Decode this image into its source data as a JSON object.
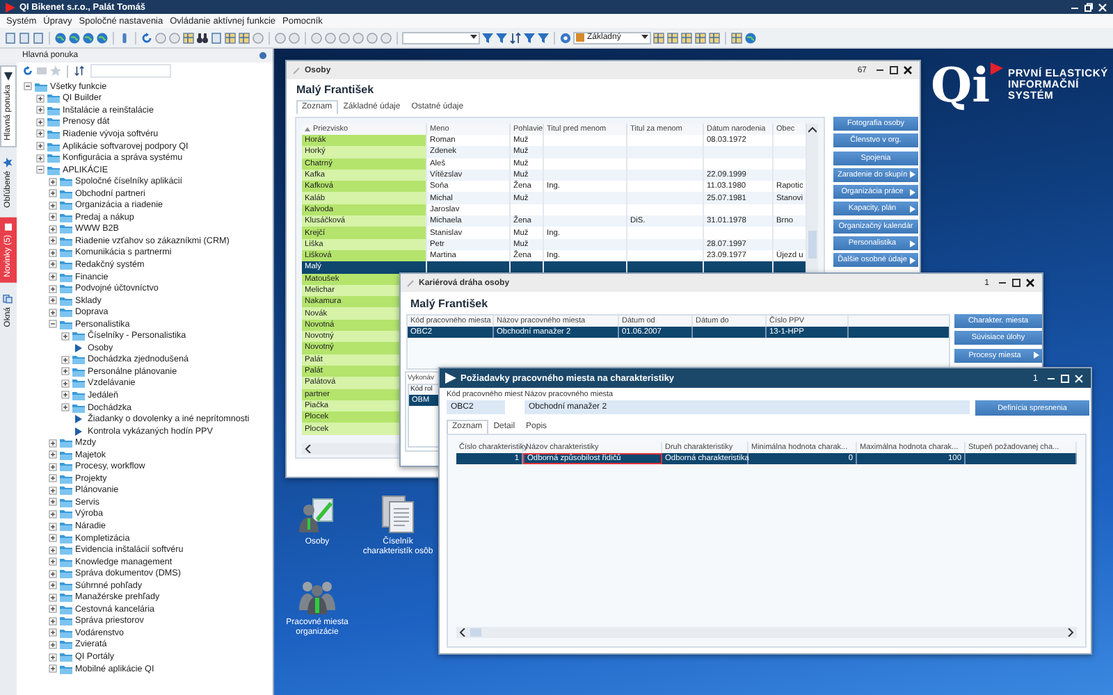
{
  "app": {
    "title": "QI Bikenet s.r.o., Palát Tomáš"
  },
  "menu": [
    "Systém",
    "Úpravy",
    "Spoločné nastavenia",
    "Ovládanie aktívnej funkcie",
    "Pomocník"
  ],
  "toolbar": {
    "view": "Základný"
  },
  "side_tabs": [
    {
      "label": "Hlavná ponuka",
      "kind": "menu",
      "selected": true
    },
    {
      "label": "Obľúbené",
      "kind": "favorites",
      "selected": false
    },
    {
      "label": "Novinky (5)",
      "kind": "news",
      "selected": false
    },
    {
      "label": "Okná",
      "kind": "windows",
      "selected": false
    }
  ],
  "main_menu": {
    "title": "Hlavná ponuka",
    "tree": [
      {
        "label": "Všetky funkcie",
        "kind": "folder",
        "expanded": true,
        "children": [
          {
            "label": "QI Builder",
            "kind": "folder",
            "expanded": false
          },
          {
            "label": "Inštalácie a reinštalácie",
            "kind": "folder",
            "expanded": false
          },
          {
            "label": "Prenosy dát",
            "kind": "folder",
            "expanded": false
          },
          {
            "label": "Riadenie vývoja softvéru",
            "kind": "folder",
            "expanded": false
          },
          {
            "label": "Aplikácie softvarovej podpory QI",
            "kind": "folder",
            "expanded": false
          },
          {
            "label": "Konfigurácia a správa systému",
            "kind": "folder",
            "expanded": false
          },
          {
            "label": "APLIKÁCIE",
            "kind": "folder",
            "expanded": true,
            "children": [
              {
                "label": "Spoločné číselníky aplikácií",
                "kind": "folder",
                "expanded": false
              },
              {
                "label": "Obchodní partneri",
                "kind": "folder",
                "expanded": false
              },
              {
                "label": "Organizácia a riadenie",
                "kind": "folder",
                "expanded": false
              },
              {
                "label": "Predaj a nákup",
                "kind": "folder",
                "expanded": false
              },
              {
                "label": "WWW B2B",
                "kind": "folder",
                "expanded": false
              },
              {
                "label": "Riadenie vzťahov so zákazníkmi (CRM)",
                "kind": "folder",
                "expanded": false
              },
              {
                "label": "Komunikácia s partnermi",
                "kind": "folder",
                "expanded": false
              },
              {
                "label": "Redakčný systém",
                "kind": "folder",
                "expanded": false
              },
              {
                "label": "Financie",
                "kind": "folder",
                "expanded": false
              },
              {
                "label": "Podvojné účtovníctvo",
                "kind": "folder",
                "expanded": false
              },
              {
                "label": "Sklady",
                "kind": "folder",
                "expanded": false
              },
              {
                "label": "Doprava",
                "kind": "folder",
                "expanded": false
              },
              {
                "label": "Personalistika",
                "kind": "folder",
                "expanded": true,
                "children": [
                  {
                    "label": "Číselníky - Personalistika",
                    "kind": "folder",
                    "expanded": false
                  },
                  {
                    "label": "Osoby",
                    "kind": "function"
                  },
                  {
                    "label": "Dochádzka zjednodušená",
                    "kind": "folder",
                    "expanded": false
                  },
                  {
                    "label": "Personálne plánovanie",
                    "kind": "folder",
                    "expanded": false
                  },
                  {
                    "label": "Vzdelávanie",
                    "kind": "folder",
                    "expanded": false
                  },
                  {
                    "label": "Jedáleň",
                    "kind": "folder",
                    "expanded": false
                  },
                  {
                    "label": "Dochádzka",
                    "kind": "folder",
                    "expanded": false
                  },
                  {
                    "label": "Žiadanky o dovolenky a iné neprítomnosti",
                    "kind": "function"
                  },
                  {
                    "label": "Kontrola vykázaných hodín PPV",
                    "kind": "function"
                  }
                ]
              },
              {
                "label": "Mzdy",
                "kind": "folder",
                "expanded": false
              },
              {
                "label": "Majetok",
                "kind": "folder",
                "expanded": false
              },
              {
                "label": "Procesy, workflow",
                "kind": "folder",
                "expanded": false
              },
              {
                "label": "Projekty",
                "kind": "folder",
                "expanded": false
              },
              {
                "label": "Plánovanie",
                "kind": "folder",
                "expanded": false
              },
              {
                "label": "Servis",
                "kind": "folder",
                "expanded": false
              },
              {
                "label": "Výroba",
                "kind": "folder",
                "expanded": false
              },
              {
                "label": "Náradie",
                "kind": "folder",
                "expanded": false
              },
              {
                "label": "Kompletizácia",
                "kind": "folder",
                "expanded": false
              },
              {
                "label": "Evidencia inštalácií softvéru",
                "kind": "folder",
                "expanded": false
              },
              {
                "label": "Knowledge management",
                "kind": "folder",
                "expanded": false
              },
              {
                "label": "Správa dokumentov (DMS)",
                "kind": "folder",
                "expanded": false
              },
              {
                "label": "Súhrnné pohľady",
                "kind": "folder",
                "expanded": false
              },
              {
                "label": "Manažérske prehľady",
                "kind": "folder",
                "expanded": false
              },
              {
                "label": "Cestovná kancelária",
                "kind": "folder",
                "expanded": false
              },
              {
                "label": "Správa priestorov",
                "kind": "folder",
                "expanded": false
              },
              {
                "label": "Vodárenstvo",
                "kind": "folder",
                "expanded": false
              },
              {
                "label": "Zvieratá",
                "kind": "folder",
                "expanded": false
              },
              {
                "label": "QI Portály",
                "kind": "folder",
                "expanded": false
              },
              {
                "label": "Mobilné aplikácie QI",
                "kind": "folder",
                "expanded": false
              }
            ]
          }
        ]
      }
    ]
  },
  "logo": {
    "mark": "Qi",
    "lines": [
      "PRVNÍ ELASTICKÝ",
      "INFORMAČNÍ",
      "SYSTÉM"
    ]
  },
  "osoby": {
    "title": "Osoby",
    "count": "67",
    "heading": "Malý František",
    "tabs": [
      {
        "label": "Zoznam",
        "selected": true
      },
      {
        "label": "Základné údaje",
        "selected": false
      },
      {
        "label": "Ostatné údaje",
        "selected": false
      }
    ],
    "columns": [
      {
        "label": "Priezvisko",
        "sorted": true
      },
      {
        "label": "Meno",
        "sorted": false
      },
      {
        "label": "Pohlavie",
        "sorted": false
      },
      {
        "label": "Titul pred menom",
        "sorted": false
      },
      {
        "label": "Titul za menom",
        "sorted": false
      },
      {
        "label": "Dátum narodenia",
        "sorted": false
      },
      {
        "label": "Obec",
        "sorted": false
      }
    ],
    "rows": [
      {
        "surname": "Horák",
        "first_name": "Roman",
        "gender": "Muž",
        "birth_date": "08.03.1972",
        "selected": false
      },
      {
        "surname": "Horký",
        "first_name": "Zdenek",
        "gender": "Muž",
        "selected": false
      },
      {
        "surname": "Chatrný",
        "first_name": "Aleš",
        "gender": "Muž",
        "selected": false
      },
      {
        "surname": "Kafka",
        "first_name": "Vítězslav",
        "gender": "Muž",
        "birth_date": "22.09.1999",
        "selected": false
      },
      {
        "surname": "Kafková",
        "first_name": "Soňa",
        "gender": "Žena",
        "title_before": "Ing.",
        "birth_date": "11.03.1980",
        "city": "Rapotic",
        "selected": false
      },
      {
        "surname": "Kaláb",
        "first_name": "Michal",
        "gender": "Muž",
        "birth_date": "25.07.1981",
        "city": "Stanovi",
        "selected": false
      },
      {
        "surname": "Kalvoda",
        "first_name": "Jaroslav",
        "selected": false
      },
      {
        "surname": "Klusáčková",
        "first_name": "Michaela",
        "gender": "Žena",
        "title_after": "DiS.",
        "birth_date": "31.01.1978",
        "city": "Brno",
        "selected": false
      },
      {
        "surname": "Krejčí",
        "first_name": "Stanislav",
        "gender": "Muž",
        "title_before": "Ing.",
        "selected": false
      },
      {
        "surname": "Liška",
        "first_name": "Petr",
        "gender": "Muž",
        "birth_date": "28.07.1997",
        "selected": false
      },
      {
        "surname": "Lišková",
        "first_name": "Martina",
        "gender": "Žena",
        "title_before": "Ing.",
        "birth_date": "23.09.1977",
        "city": "Újezd u",
        "selected": false
      },
      {
        "surname": "Malý",
        "selected": true
      },
      {
        "surname": "Matoušek",
        "selected": false
      },
      {
        "surname": "Melichar",
        "selected": false
      },
      {
        "surname": "Nakamura",
        "selected": false
      },
      {
        "surname": "Novák",
        "selected": false
      },
      {
        "surname": "Novotná",
        "selected": false
      },
      {
        "surname": "Novotný",
        "selected": false
      },
      {
        "surname": "Novotný",
        "selected": false
      },
      {
        "surname": "Palát",
        "selected": false
      },
      {
        "surname": "Palát",
        "selected": false
      },
      {
        "surname": "Palátová",
        "selected": false
      },
      {
        "surname": "partner",
        "selected": false
      },
      {
        "surname": "Piačka",
        "selected": false
      },
      {
        "surname": "Plocek",
        "selected": false
      },
      {
        "surname": "Plocek",
        "selected": false
      }
    ],
    "buttons": [
      {
        "label": "Fotografia osoby",
        "submenu": false
      },
      {
        "label": "Členstvo v org.",
        "submenu": false
      },
      {
        "label": "Spojenia",
        "submenu": false
      },
      {
        "label": "Zaradenie do skupín",
        "submenu": true
      },
      {
        "label": "Organizácia práce",
        "submenu": true
      },
      {
        "label": "Kapacity, plán",
        "submenu": true
      },
      {
        "label": "Organizačný kalendár",
        "submenu": false
      },
      {
        "label": "Personalistika",
        "submenu": true
      },
      {
        "label": "Ďalšie osobné údaje",
        "submenu": true
      }
    ]
  },
  "career": {
    "title": "Kariérová dráha osoby",
    "count": "1",
    "heading": "Malý František",
    "columns": [
      "Kód pracovného miesta",
      "Názov pracovného miesta",
      "Dátum od",
      "Dátum do",
      "Číslo PPV"
    ],
    "rows": [
      {
        "code": "OBC2",
        "name": "Obchodní manažer 2",
        "from": "01.06.2007",
        "ppv": "13-1-HPP",
        "selected": true
      }
    ],
    "buttons": [
      {
        "label": "Charakter. miesta",
        "submenu": false
      },
      {
        "label": "Súvisiace úlohy",
        "submenu": false
      },
      {
        "label": "Procesy miesta",
        "submenu": true
      }
    ],
    "group": {
      "label": "Vykonáv",
      "column": "Kód rol",
      "rows": [
        {
          "code": "OBM",
          "selected": true
        }
      ]
    }
  },
  "requirements": {
    "title": "Požiadavky pracovného miesta na charakteristiky",
    "count": "1",
    "code_label": "Kód pracovného miest",
    "code": "OBC2",
    "name_label": "Názov pracovného miesta",
    "name": "Obchodní manažer 2",
    "button": "Definícia spresnenia",
    "tabs": [
      {
        "label": "Zoznam",
        "selected": true
      },
      {
        "label": "Detail",
        "selected": false
      },
      {
        "label": "Popis",
        "selected": false
      }
    ],
    "columns": [
      {
        "label": "Číslo charakteristiky",
        "kind": "number"
      },
      {
        "label": "Názov charakteristiky",
        "kind": "text"
      },
      {
        "label": "Druh charakteristiky",
        "kind": "text"
      },
      {
        "label": "Minimálna hodnota charak...",
        "kind": "number"
      },
      {
        "label": "Maximálna hodnota charak...",
        "kind": "number"
      },
      {
        "label": "Stupeň požadovanej cha...",
        "kind": "text"
      }
    ],
    "rows": [
      {
        "selected": true,
        "cells": [
          {
            "text": "1",
            "focused": false
          },
          {
            "text": "Odborná způsobilost řidičů",
            "focused": true
          },
          {
            "text": "Odborná charakteristika",
            "focused": false
          },
          {
            "text": "0",
            "focused": false
          },
          {
            "text": "100",
            "focused": false
          }
        ]
      }
    ]
  },
  "desktop_icons": [
    {
      "label": "Osoby",
      "kind": "person-edit"
    },
    {
      "label": "Číselník charakteristík osôb",
      "kind": "documents"
    },
    {
      "label": "Pracovné miesta organizácie",
      "kind": "group"
    }
  ]
}
